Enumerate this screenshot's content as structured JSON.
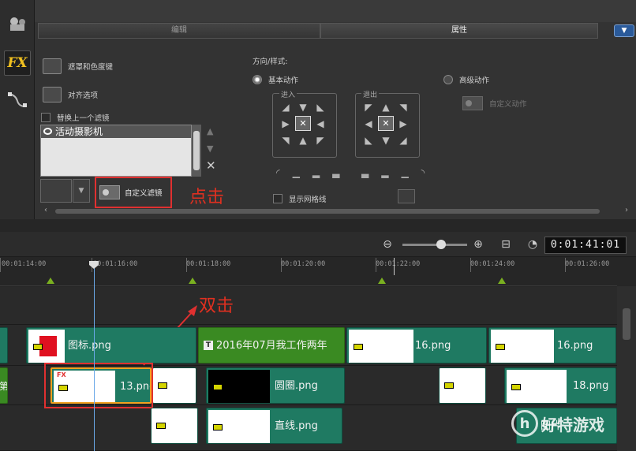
{
  "tabs": {
    "edit": "编辑",
    "properties": "属性"
  },
  "collapse_icon": "chevron-down-icon",
  "left_options": {
    "mask_chroma": "遮罩和色度键",
    "align": "对齐选项",
    "replace_prev_filter": "替换上一个滤镜",
    "filter_item": "活动摄影机",
    "custom_filter": "自定义滤镜"
  },
  "annotations": {
    "click": "点击",
    "double_click": "双击"
  },
  "direction": {
    "title": "方向/样式:",
    "basic_motion": "基本动作",
    "advanced_motion": "高级动作",
    "enter": "进入",
    "exit": "退出",
    "custom_motion": "自定义动作",
    "show_grid": "显示网格线"
  },
  "timeline": {
    "timecode": "0:01:41:01",
    "ruler": [
      "00:01:14:00",
      "00:01:16:00",
      "00:01:18:00",
      "00:01:20:00",
      "00:01:22:00",
      "00:01:24:00",
      "00:01:26:00"
    ],
    "track1": [
      "图标.png",
      "2016年07月我工作两年",
      "16.png",
      "16.png"
    ],
    "track2": [
      "第",
      "13.png",
      "圆圈.png",
      "18.png"
    ],
    "track3": [
      "直线.png",
      "图片"
    ]
  },
  "watermark": "好特游戏",
  "colors": {
    "accent_red": "#e03030",
    "clip_teal": "#1f7a62",
    "clip_green": "#3a8a22",
    "selected_orange": "#f0a020"
  }
}
